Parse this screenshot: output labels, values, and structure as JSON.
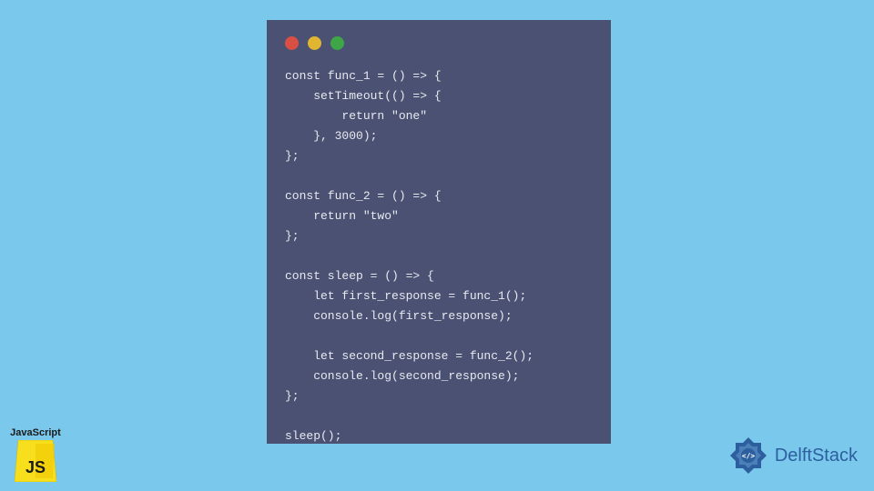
{
  "code": {
    "lines": "const func_1 = () => {\n    setTimeout(() => {\n        return \"one\"\n    }, 3000);\n};\n\nconst func_2 = () => {\n    return \"two\"\n};\n\nconst sleep = () => {\n    let first_response = func_1();\n    console.log(first_response);\n\n    let second_response = func_2();\n    console.log(second_response);\n};\n\nsleep();"
  },
  "js_badge": {
    "label": "JavaScript",
    "logo_text": "JS"
  },
  "brand": {
    "name": "DelftStack"
  },
  "colors": {
    "window_bg": "#4a5172",
    "page_bg": "#7ac9ed",
    "js_yellow": "#f7df1e",
    "brand_blue": "#2d5f9e"
  }
}
